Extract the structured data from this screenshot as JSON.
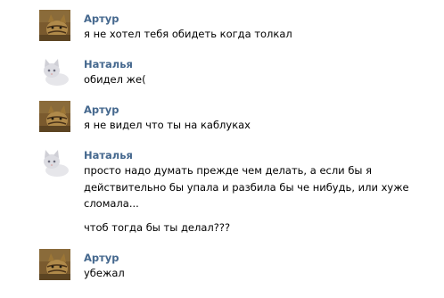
{
  "colors": {
    "author": "#45688e",
    "text": "#000000",
    "background": "#ffffff"
  },
  "messages": [
    {
      "author": "Артур",
      "avatar": "tiger-cat-avatar",
      "lines": [
        "я не хотел тебя обидеть когда толкал"
      ]
    },
    {
      "author": "Наталья",
      "avatar": "white-kitten-avatar",
      "lines": [
        "обидел же("
      ]
    },
    {
      "author": "Артур",
      "avatar": "tiger-cat-avatar",
      "lines": [
        "я не видел что ты на каблуках"
      ]
    },
    {
      "author": "Наталья",
      "avatar": "white-kitten-avatar",
      "lines": [
        "просто надо думать прежде чем делать, а если бы я",
        "действительно бы упала и разбила бы че нибудь, или хуже",
        "сломала...",
        "чтоб тогда бы ты делал???"
      ]
    },
    {
      "author": "Артур",
      "avatar": "tiger-cat-avatar",
      "lines": [
        "убежал"
      ]
    }
  ]
}
